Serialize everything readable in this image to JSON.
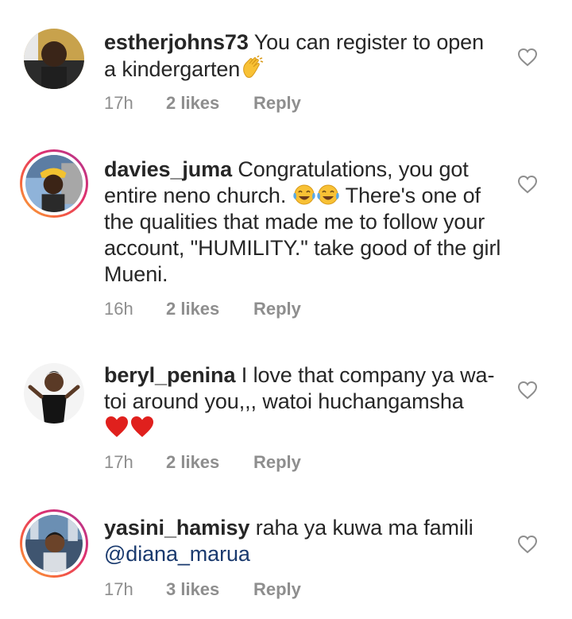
{
  "comments": [
    {
      "username": "estherjohns73",
      "text": " You can register to open a kindergarten",
      "emoji": "clapping-hands",
      "time": "17h",
      "likes": "2 likes",
      "reply": "Reply"
    },
    {
      "username": "davies_juma",
      "text_before": " Congratulations, you got entire neno church. ",
      "text_after": " There's one of the qualities that made me to follow your account, \"HUMILITY.\" take good of the girl Mueni.",
      "emoji": "face-with-tears-of-joy",
      "time": "16h",
      "likes": "2 likes",
      "reply": "Reply"
    },
    {
      "username": "beryl_penina",
      "text": " I love that company ya wa-toi around you,,, watoi huchangamsha",
      "emoji": "red-heart",
      "time": "17h",
      "likes": "2 likes",
      "reply": "Reply"
    },
    {
      "username": "yasini_hamisy",
      "text": " raha ya kuwa ma famili",
      "mention": "@diana_marua",
      "time": "17h",
      "likes": "3 likes",
      "reply": "Reply"
    }
  ],
  "colors": {
    "text": "#262626",
    "meta": "#8e8e8e",
    "mention": "#1a3a6e",
    "heart_outline": "#8e8e8e"
  }
}
